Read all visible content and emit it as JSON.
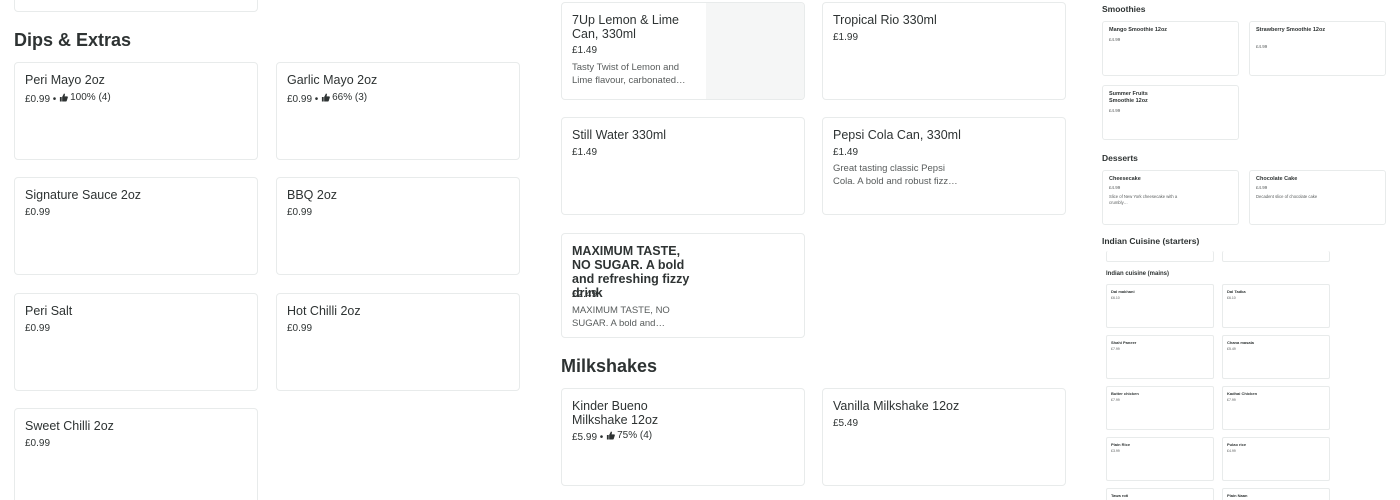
{
  "dips": {
    "title": "Dips & Extras",
    "items": [
      {
        "name": "Peri Mayo 2oz",
        "price": "£0.99",
        "sep": " •",
        "rating": "100% (4)"
      },
      {
        "name": "Garlic Mayo 2oz",
        "price": "£0.99",
        "sep": " •",
        "rating": "66% (3)"
      },
      {
        "name": "Signature Sauce 2oz",
        "price": "£0.99"
      },
      {
        "name": "BBQ 2oz",
        "price": "£0.99"
      },
      {
        "name": "Peri Salt",
        "price": "£0.99"
      },
      {
        "name": "Hot Chilli 2oz",
        "price": "£0.99"
      },
      {
        "name": "Sweet Chilli 2oz",
        "price": "£0.99"
      }
    ]
  },
  "drinks": {
    "items": [
      {
        "name": "7Up Lemon & Lime Can, 330ml",
        "price": "£1.49",
        "desc": "Tasty Twist of Lemon and Lime flavour, carbonated…"
      },
      {
        "name": "Tropical Rio 330ml",
        "price": "£1.99"
      },
      {
        "name": "Still Water 330ml",
        "price": "£1.49"
      },
      {
        "name": "Pepsi Cola Can, 330ml",
        "price": "£1.49",
        "desc": "Great tasting classic Pepsi Cola. A bold and robust fizz…"
      },
      {
        "name": "MAXIMUM TASTE, NO SUGAR. A bold and refreshing fizzy drink",
        "price": "£2.49",
        "desc": "MAXIMUM TASTE, NO SUGAR. A bold and…"
      }
    ]
  },
  "milkshakes": {
    "title": "Milkshakes",
    "items": [
      {
        "name": "Kinder Bueno Milkshake 12oz",
        "price": "£5.99",
        "sep": " •",
        "rating": "75% (4)"
      },
      {
        "name": "Vanilla Milkshake 12oz",
        "price": "£5.49"
      }
    ]
  },
  "preview": {
    "smoothies_title": "Smoothies",
    "smoothies": [
      {
        "name": "Mango Smoothie 12oz",
        "price": "£4.99"
      },
      {
        "name": "Strawberry Smoothie 12oz",
        "price": "£4.99"
      },
      {
        "name": "Summer Fruits Smoothie 12oz",
        "price": "£4.99"
      }
    ],
    "desserts_title": "Desserts",
    "desserts": [
      {
        "name": "Cheesecake",
        "price": "£4.99",
        "desc": "Slice of New York cheesecake with a crumbly…"
      },
      {
        "name": "Chocolate Cake",
        "price": "£4.99",
        "desc": "Decadent slice of chocolate cake"
      }
    ],
    "starters_title": "Indian Cuisine (starters)",
    "mains_title": "Indian cuisine (mains)",
    "mains": [
      {
        "name": "Dal makhani",
        "price": "£6.10"
      },
      {
        "name": "Dal Tadka",
        "price": "£6.10"
      },
      {
        "name": "Shahi Paneer",
        "price": "£7.99"
      },
      {
        "name": "Chana masala",
        "price": "£5.49"
      },
      {
        "name": "Butter chicken",
        "price": "£7.99"
      },
      {
        "name": "Kadhai Chicken",
        "price": "£7.99"
      },
      {
        "name": "Plain Rice",
        "price": "£3.99"
      },
      {
        "name": "Pulao rice",
        "price": "£4.99"
      },
      {
        "name": "Tawa roti",
        "price": ""
      },
      {
        "name": "Plain Naan",
        "price": ""
      }
    ]
  },
  "colors": {
    "text": "#2e3333",
    "secondary": "#585c5c",
    "border": "#e8ebeb"
  },
  "icons": {
    "rating": "thumbs-up-icon"
  }
}
